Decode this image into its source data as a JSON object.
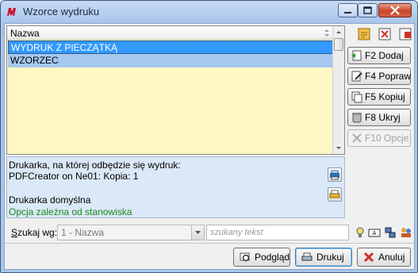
{
  "window": {
    "title": "Wzorce wydruku"
  },
  "list": {
    "header": "Nazwa",
    "rows": [
      "WYDRUK Z PIECZĄTKĄ",
      "WZORZEC"
    ],
    "selected_index": 0
  },
  "info": {
    "printer_caption": "Drukarka, na której odbędzie się wydruk:",
    "printer_value": "PDFCreator on Ne01:  Kopia: 1",
    "printer_default": "Drukarka domyślna",
    "station_note": "Opcja zależna od stanowiska"
  },
  "side_buttons": {
    "add": "F2 Dodaj",
    "edit": "F4 Popraw",
    "copy": "F5 Kopiuj",
    "hide": "F8 Ukryj",
    "options": "F10 Opcje"
  },
  "search": {
    "label": "Szukaj wg:",
    "select_value": "1 - Nazwa",
    "placeholder": "szukany tekst"
  },
  "footer": {
    "preview": "Podgląd",
    "print": "Drukuj",
    "cancel": "Anuluj"
  },
  "colors": {
    "selection": "#3399ff",
    "list_bg": "#fff7c4",
    "info_bg": "#dbe8f7",
    "green_note": "#1a8a1a"
  }
}
